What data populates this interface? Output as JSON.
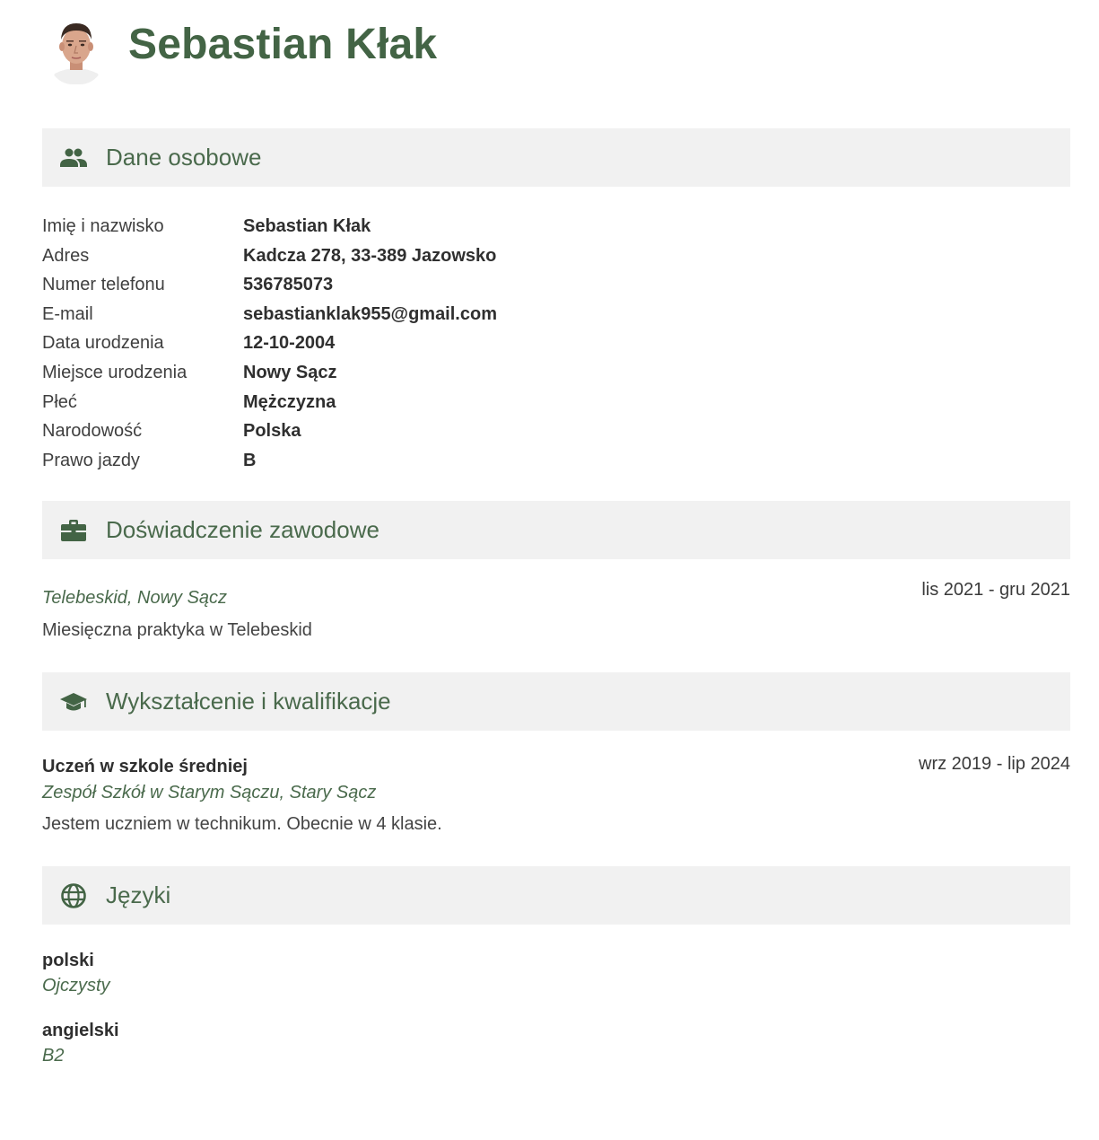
{
  "header": {
    "name": "Sebastian Kłak",
    "avatar_icon": "person-photo"
  },
  "colors": {
    "accent": "#436445",
    "section_bg": "#f1f1f1",
    "text": "#333333"
  },
  "sections": {
    "personal": {
      "title": "Dane osobowe",
      "icon": "people-icon",
      "rows": [
        {
          "label": "Imię i nazwisko",
          "value": "Sebastian Kłak"
        },
        {
          "label": "Adres",
          "value": "Kadcza 278, 33-389 Jazowsko"
        },
        {
          "label": "Numer telefonu",
          "value": "536785073"
        },
        {
          "label": "E-mail",
          "value": "sebastianklak955@gmail.com"
        },
        {
          "label": "Data urodzenia",
          "value": "12-10-2004"
        },
        {
          "label": "Miejsce urodzenia",
          "value": "Nowy Sącz"
        },
        {
          "label": "Płeć",
          "value": "Mężczyzna"
        },
        {
          "label": "Narodowość",
          "value": "Polska"
        },
        {
          "label": "Prawo jazdy",
          "value": "B"
        }
      ]
    },
    "experience": {
      "title": "Doświadczenie zawodowe",
      "icon": "briefcase-icon",
      "items": [
        {
          "org": "Telebeskid, Nowy Sącz",
          "date": "lis 2021 - gru 2021",
          "description": "Miesięczna praktyka w Telebeskid"
        }
      ]
    },
    "education": {
      "title": "Wykształcenie i kwalifikacje",
      "icon": "graduation-cap-icon",
      "items": [
        {
          "title": "Uczeń w szkole średniej",
          "org": "Zespół Szkół w Starym Sączu, Stary Sącz",
          "date": "wrz 2019 - lip 2024",
          "description": "Jestem uczniem w technikum. Obecnie w 4 klasie."
        }
      ]
    },
    "languages": {
      "title": "Języki",
      "icon": "globe-icon",
      "items": [
        {
          "name": "polski",
          "level": "Ojczysty"
        },
        {
          "name": "angielski",
          "level": "B2"
        }
      ]
    }
  }
}
